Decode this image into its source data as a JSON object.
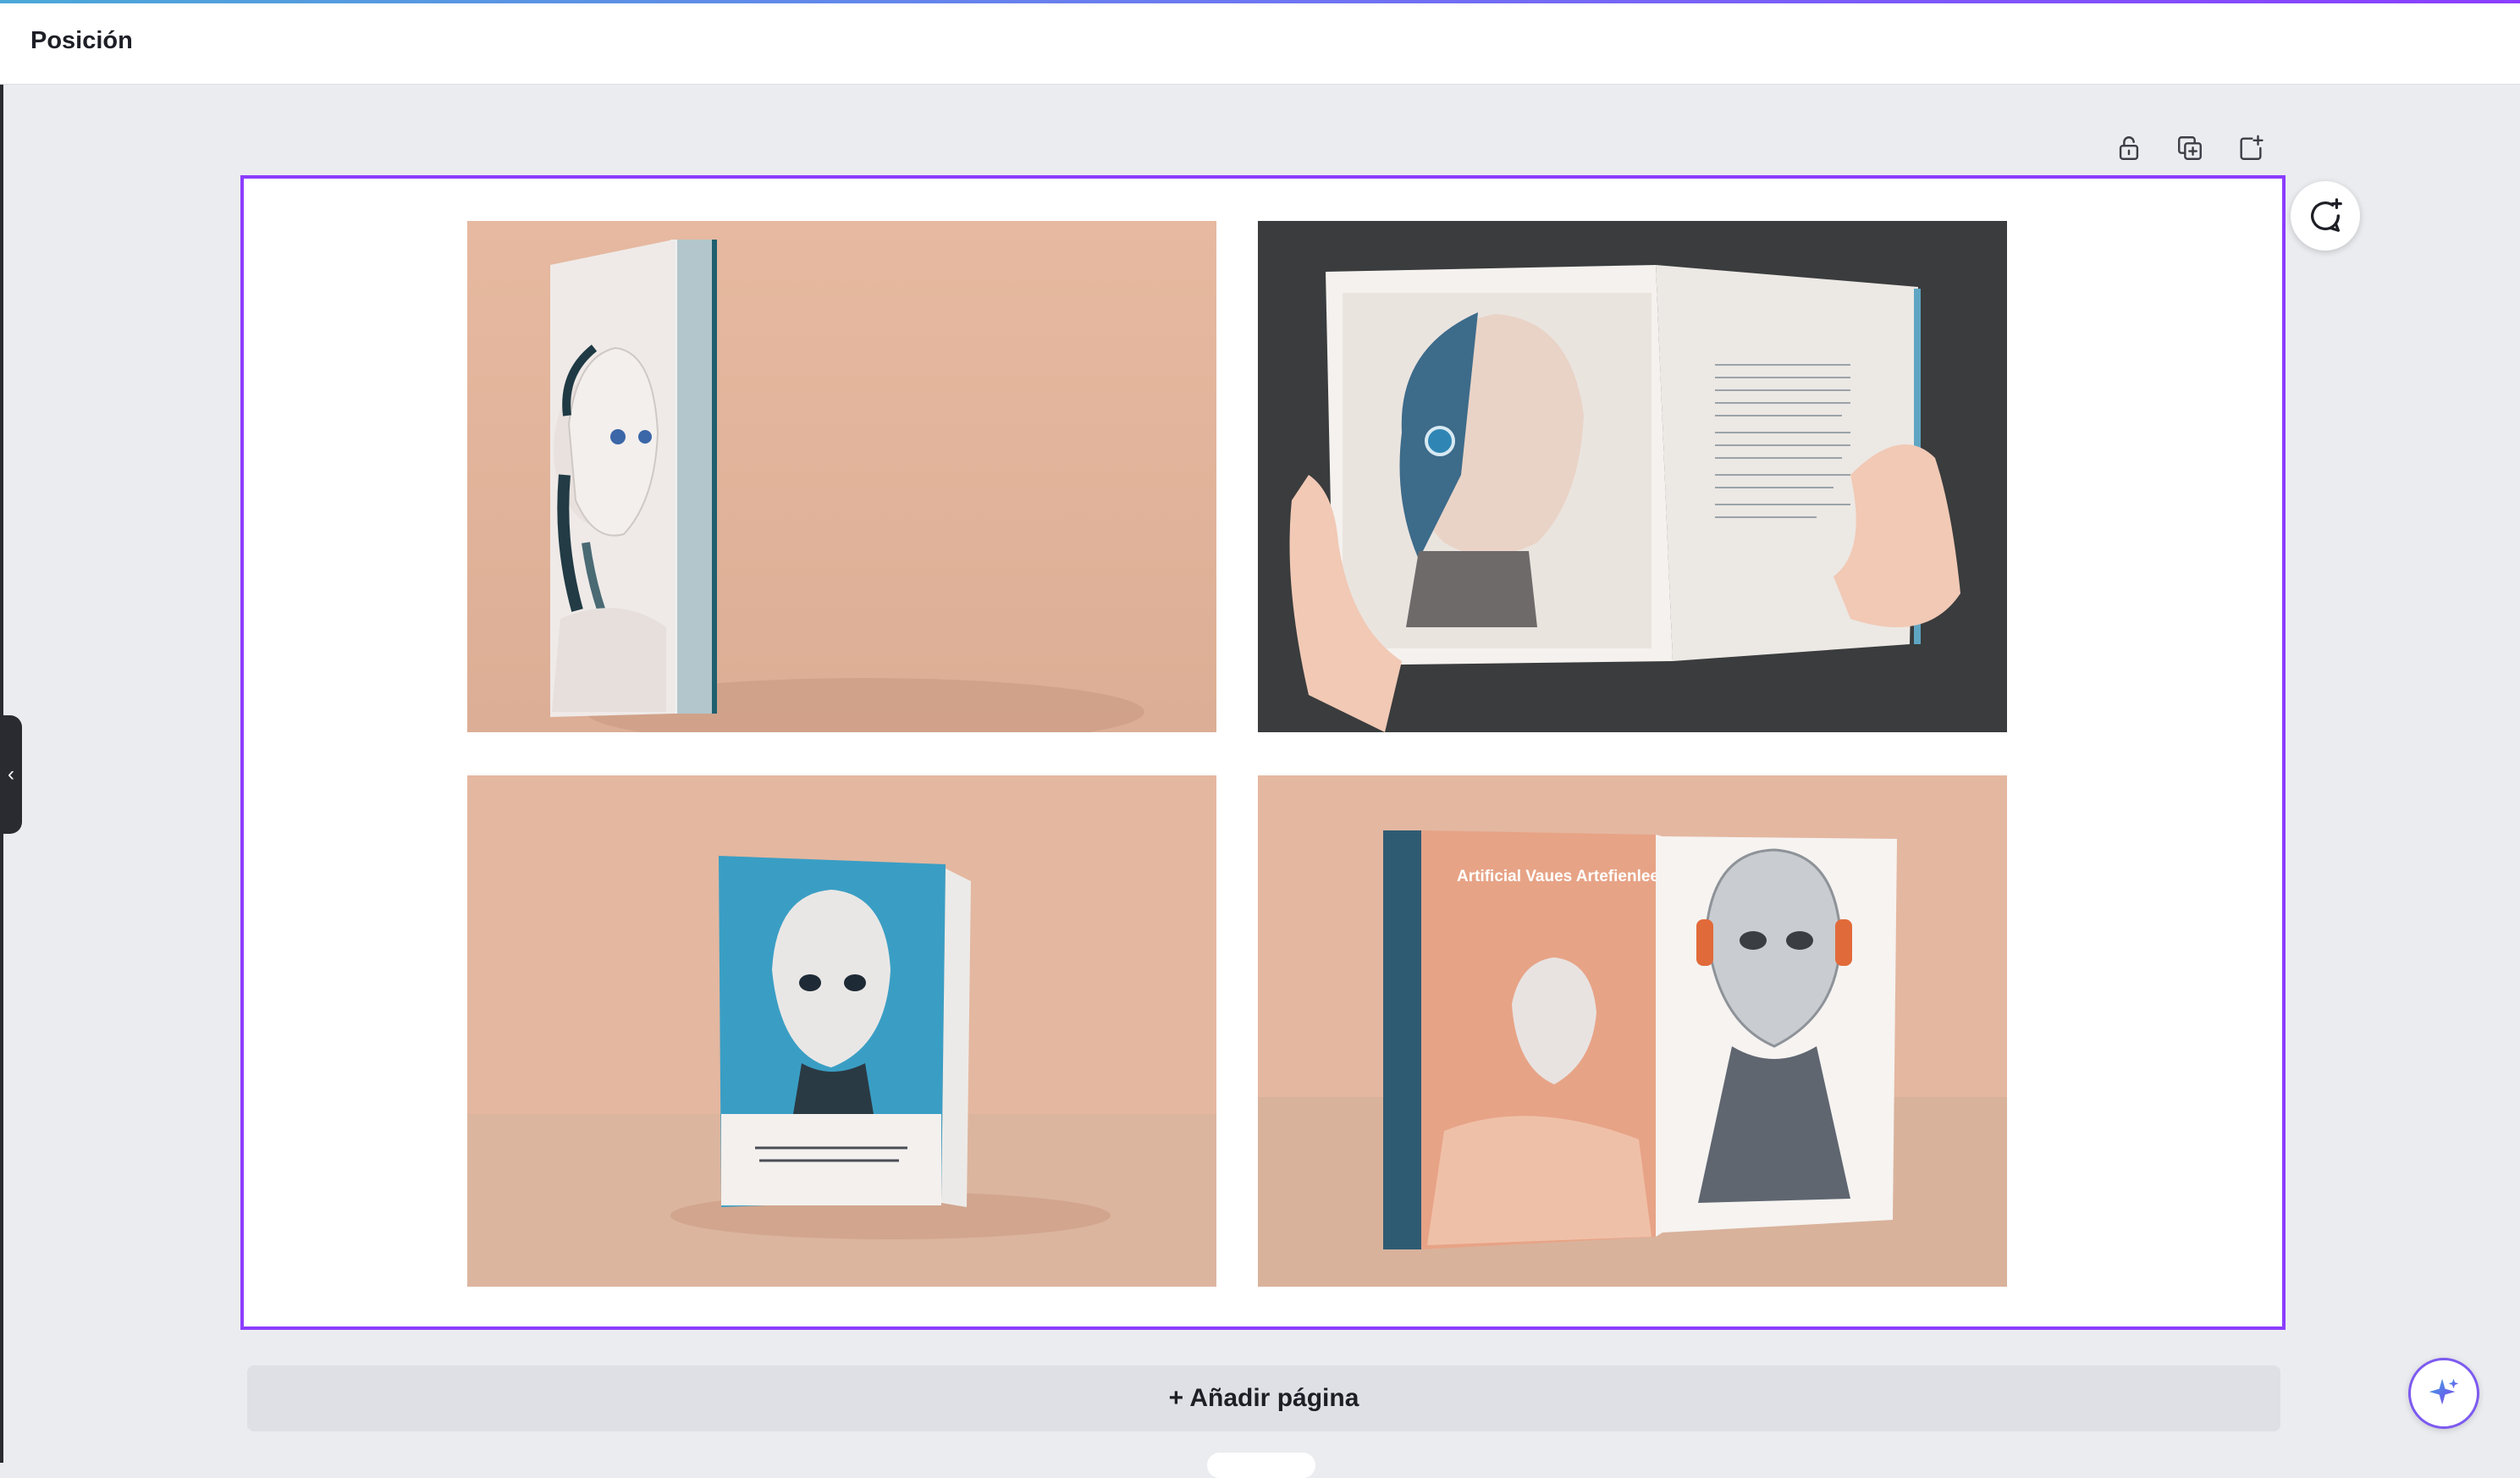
{
  "topbar": {
    "title": "Posición"
  },
  "toolbar": {
    "icons": [
      "lock-icon",
      "duplicate-page-icon",
      "add-page-icon"
    ]
  },
  "colors": {
    "accent": "#8b3dff",
    "canvas_background": "#ebecf0",
    "photo_backdrop_peach": "#e6b9a0",
    "photo_backdrop_dark": "#3a3c3d",
    "cover_blue": "#3a9ec4"
  },
  "canvas": {
    "photos": [
      {
        "alt": "libro-portada-robot-1"
      },
      {
        "alt": "libro-abierto-robot"
      },
      {
        "alt": "libro-portada-azul-robot"
      },
      {
        "alt": "dos-libros-robot"
      }
    ],
    "book_cover_text": "Artificial Vaues Artefienleeparcat"
  },
  "actions": {
    "add_page": "+ Añadir página"
  }
}
